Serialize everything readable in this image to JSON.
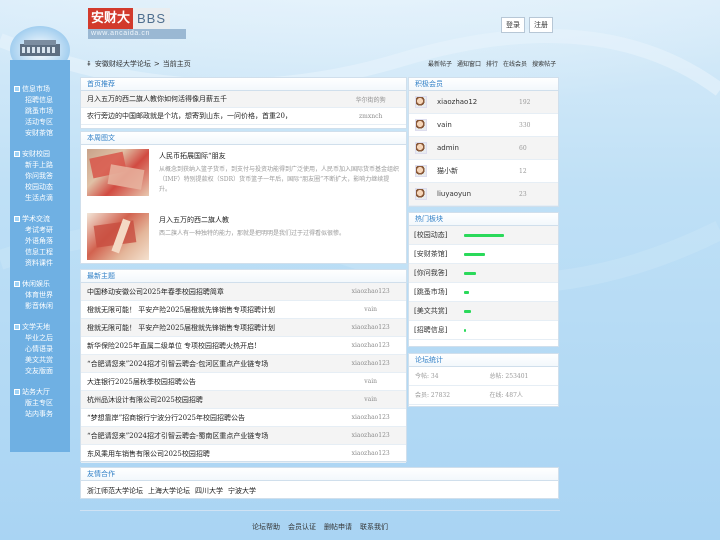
{
  "logo": {
    "brand": "安财大",
    "bbs": "BBS",
    "url": "www.ancaida.cn"
  },
  "auth": {
    "login": "登录",
    "register": "注册"
  },
  "breadcrumb": {
    "home": "安徽财经大学论坛",
    "sep": ">",
    "current": "当前主页"
  },
  "topnav": [
    "最新帖子",
    "通知窗口",
    "排行",
    "在线会员",
    "搜索帖子"
  ],
  "sidebar": [
    {
      "title": "信息市场",
      "items": [
        "招聘信息",
        "跳蚤市场",
        "活动专区",
        "安财茶馆"
      ]
    },
    {
      "title": "安财校园",
      "items": [
        "新手上路",
        "你问我答",
        "校园动态",
        "生活点滴"
      ]
    },
    {
      "title": "学术交流",
      "items": [
        "考试考研",
        "外语角落",
        "信息工程",
        "资料课件"
      ]
    },
    {
      "title": "休闲娱乐",
      "items": [
        "体育世界",
        "影音休闲"
      ]
    },
    {
      "title": "文学天地",
      "items": [
        "毕业之后",
        "心情语录",
        "美文共赏",
        "交友版面"
      ]
    },
    {
      "title": "站务大厅",
      "items": [
        "版主专区",
        "站内事务"
      ]
    }
  ],
  "recommend": {
    "heading": "首页推荐",
    "rows": [
      {
        "title": "月入五万的西二旗人教你如何活得像月薪五千",
        "author": "华尔街的狗"
      },
      {
        "title": "农行旁边的中国邮政就是个坑，想寄到山东，一问价格，首重20，",
        "author": "zmxnch"
      }
    ]
  },
  "news": {
    "heading": "本周图文",
    "items": [
      {
        "title": "人民币拓展国际“朋友",
        "desc": "从概念到获纳入篮子货币，到支付与投资功能得到广泛使用，人民币加入国际货币基金组织（IMF）特别提款权（SDR）货币篮子一年后，国际“朋友圈”不断扩大，影响力继续提升。"
      },
      {
        "title": "月入五万的西二旗人教",
        "desc": "西二旗人有一种独特的能力，那就是把明明是我们过于过得看似很惨。"
      }
    ]
  },
  "latest": {
    "heading": "最新主题",
    "rows": [
      {
        "title": "中国移动安徽公司2025年春季校园招聘简章",
        "author": "xiaozhao123"
      },
      {
        "title": "橙就无限可能！ 平安产险2025届橙就先锋销售专项招聘计划",
        "author": "vain"
      },
      {
        "title": "橙就无限可能！ 平安产险2025届橙就先锋销售专项招聘计划",
        "author": "xiaozhao123"
      },
      {
        "title": "新华保险2025年直属二级单位 专项校园招聘火热开启!",
        "author": "xiaozhao123"
      },
      {
        "title": "“合肥请您来”2024招才引智云聘会·包河区重点产业链专场",
        "author": "xiaozhao123"
      },
      {
        "title": "大连银行2025届秋季校园招聘公告",
        "author": "vain"
      },
      {
        "title": "杭州品沐设计有限公司2025校园招聘",
        "author": "vain"
      },
      {
        "title": "“梦想靠岸”招商银行宁波分行2025年校园招聘公告",
        "author": "xiaozhao123"
      },
      {
        "title": "“合肥请您来”2024招才引智云聘会-蜀南区重点产业链专场",
        "author": "xiaozhao123"
      },
      {
        "title": "东风乘用车销售有限公司2025校园招聘",
        "author": "xiaozhao123"
      }
    ]
  },
  "active_members": {
    "heading": "积极会员",
    "users": [
      {
        "name": "xiaozhao12",
        "count": "192"
      },
      {
        "name": "vain",
        "count": "330"
      },
      {
        "name": "admin",
        "count": "60"
      },
      {
        "name": "猫小新",
        "count": "12"
      },
      {
        "name": "liuyaoyun",
        "count": "23"
      }
    ]
  },
  "hot_boards": {
    "heading": "热门板块",
    "boards": [
      {
        "name": "[校园动态]",
        "level": 0.66
      },
      {
        "name": "[安财茶馆]",
        "level": 0.35
      },
      {
        "name": "[你问我答]",
        "level": 0.2
      },
      {
        "name": "[跳蚤市场]",
        "level": 0.08
      },
      {
        "name": "[美文共赏]",
        "level": 0.11
      },
      {
        "name": "[招聘信息]",
        "level": 0.03
      }
    ],
    "bar_color": "#2ad95a"
  },
  "stats": {
    "heading": "论坛统计",
    "today": "今帖: 34",
    "total": "总帖: 253401",
    "members": "会员: 27832",
    "online": "在线: 487人"
  },
  "friends": {
    "heading": "友情合作",
    "links": [
      "浙江师范大学论坛",
      "上海大学论坛",
      "四川大学",
      "宁波大学"
    ]
  },
  "footer": [
    "论坛帮助",
    "会员认证",
    "删帖申请",
    "联系我们"
  ],
  "colors": {
    "accent": "#2f7fc6",
    "sidebar": "#6fb0e3",
    "logo_red": "#d23a2c"
  }
}
